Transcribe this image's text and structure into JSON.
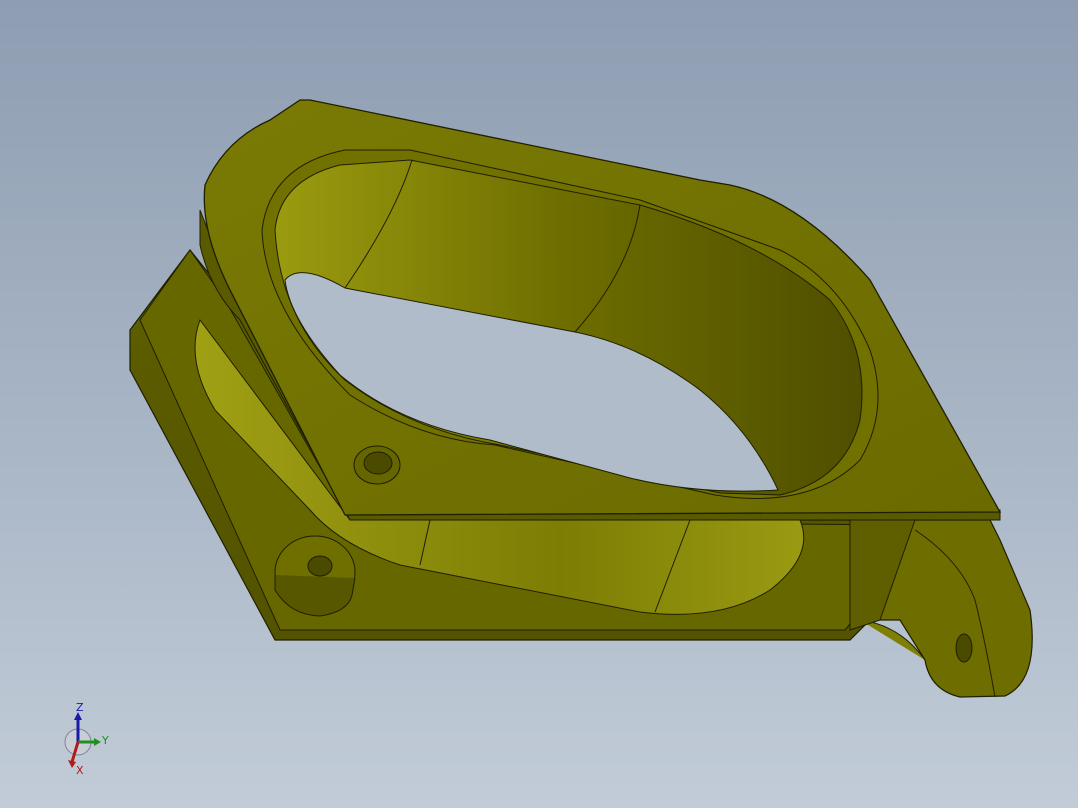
{
  "viewport": {
    "background_top": "#8e9db2",
    "background_bottom": "#c2ccd8"
  },
  "part": {
    "color_base": "#6b6b00",
    "color_light": "#8c8c0a",
    "color_dark": "#4f4f00",
    "color_highlight": "#a3a315",
    "edge_color": "#1f1f00"
  },
  "triad": {
    "z_label": "Z",
    "y_label": "Y",
    "x_label": "X",
    "z_color": "#1a1aa8",
    "y_color": "#1f8f1f",
    "x_color": "#b01a1a"
  }
}
